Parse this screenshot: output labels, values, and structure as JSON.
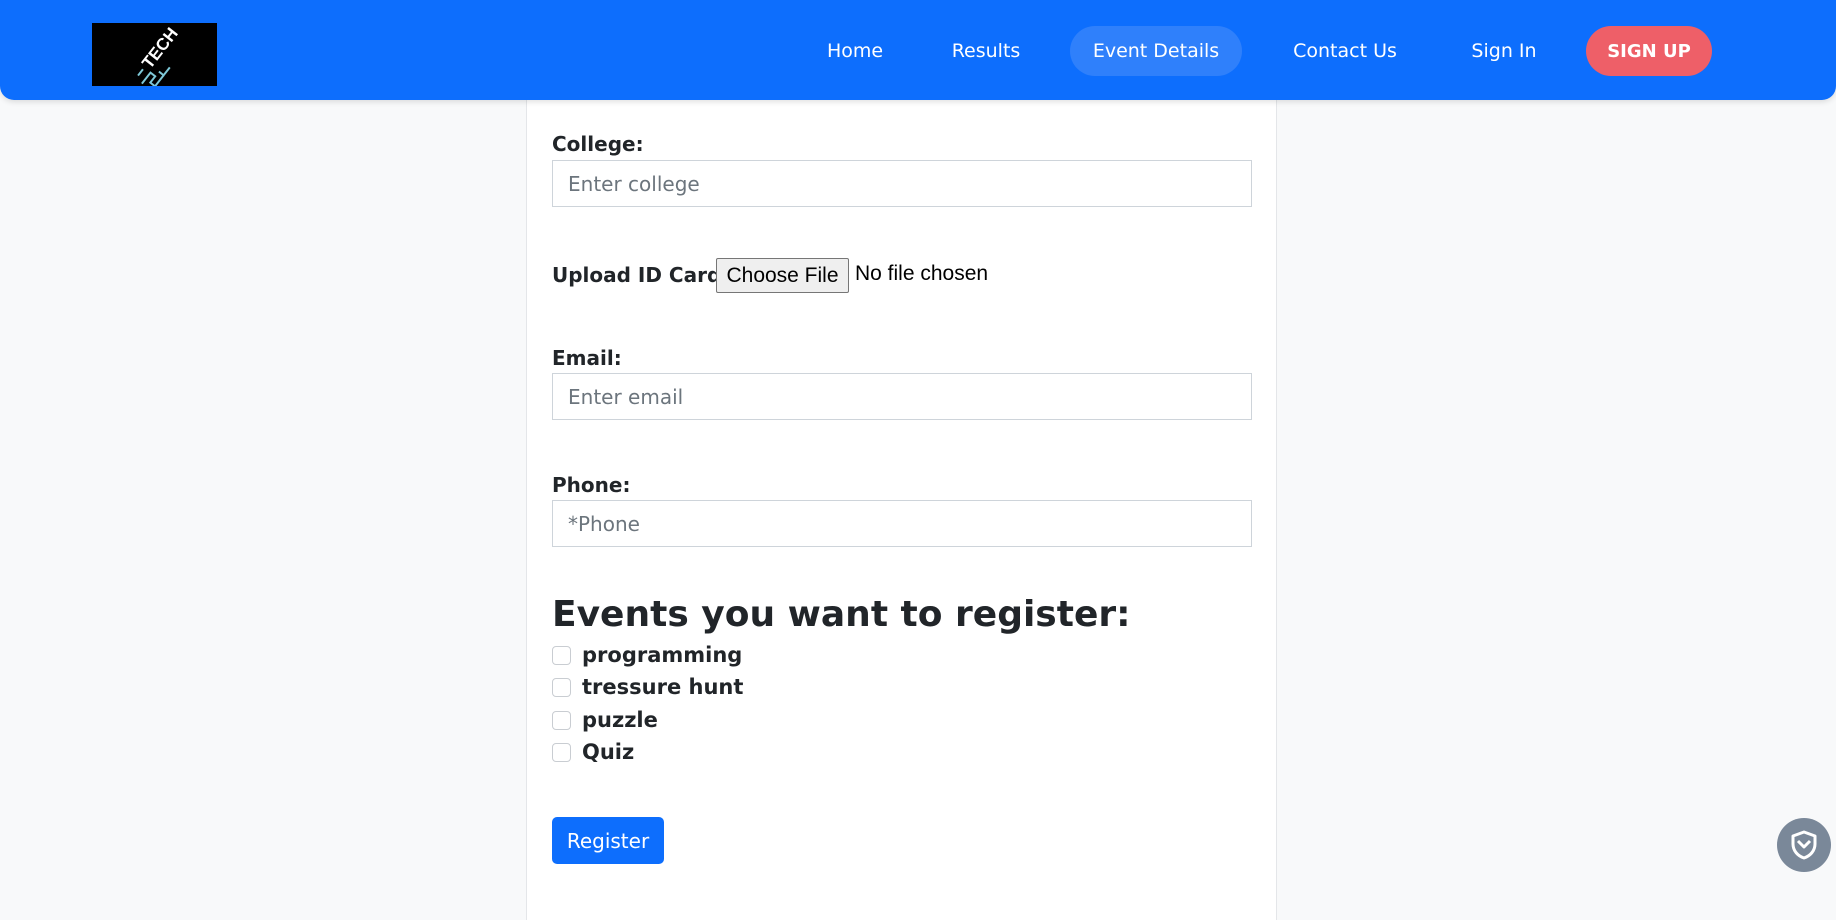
{
  "nav": {
    "logo_text": "TECH",
    "items": [
      {
        "label": "Home"
      },
      {
        "label": "Results"
      },
      {
        "label": "Event Details"
      },
      {
        "label": "Contact Us"
      },
      {
        "label": "Sign In"
      }
    ],
    "active_item": "Event Details",
    "signup_label": "SIGN UP"
  },
  "form": {
    "college": {
      "label": "College:",
      "placeholder": "Enter college",
      "value": ""
    },
    "id_card": {
      "label": "Upload ID Card:",
      "button_label": "Choose File",
      "status": "No file chosen"
    },
    "email": {
      "label": "Email:",
      "placeholder": "Enter email",
      "value": ""
    },
    "phone": {
      "label": "Phone:",
      "placeholder": "*Phone",
      "value": ""
    },
    "events_heading": "Events you want to register:",
    "events": [
      {
        "label": "programming",
        "checked": false
      },
      {
        "label": "tressure hunt",
        "checked": false
      },
      {
        "label": "puzzle",
        "checked": false
      },
      {
        "label": "Quiz",
        "checked": false
      }
    ],
    "submit_label": "Register"
  },
  "colors": {
    "navbar": "#0d6efd",
    "active_nav": "#2f80fb",
    "signup": "#ee5f68",
    "primary_button": "#0d6efd",
    "page_background": "#f8f9fa"
  },
  "icons": {
    "floating_widget": "shield-icon"
  }
}
